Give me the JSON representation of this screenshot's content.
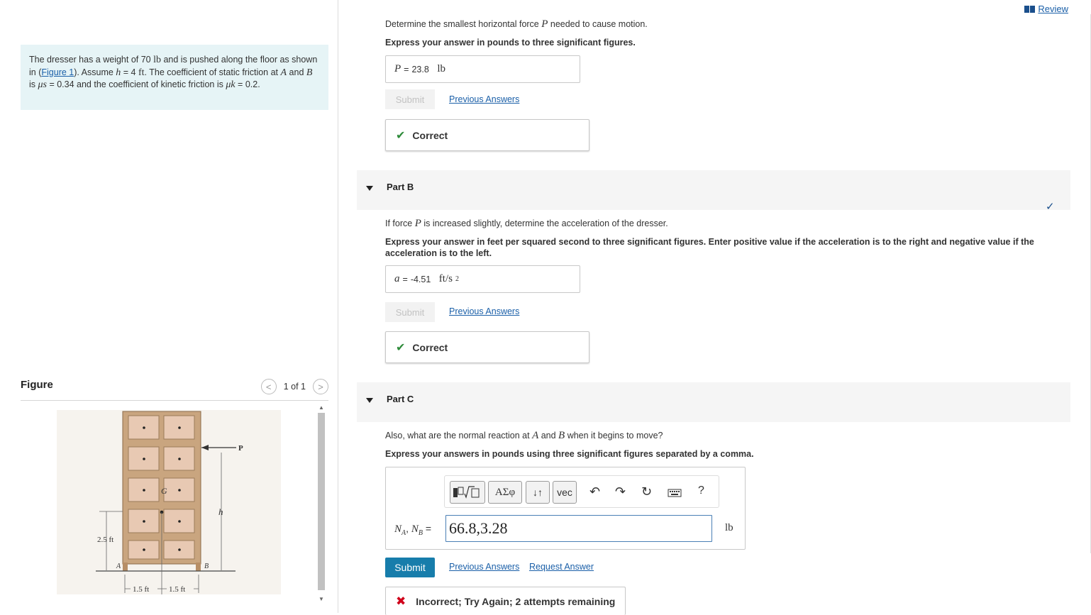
{
  "problem": {
    "t1": "The dresser has a weight of 70 ",
    "weight_unit": "lb",
    "t2": " and is pushed along the floor as shown in (",
    "figure_link": "Figure 1",
    "t3": "). Assume ",
    "h_sym": "h",
    "t4": " = 4 ",
    "ft_unit": "ft",
    "t5": ". The coefficient of static friction at ",
    "a_sym": "A",
    "t6": " and ",
    "b_sym": "B",
    "t7": " is ",
    "mus": "μs",
    "t8": " = 0.34 and the coefficient of kinetic friction is ",
    "muk": "μk",
    "t9": " = 0.2."
  },
  "figure_panel": {
    "title": "Figure",
    "page_indicator": "1 of 1",
    "prev_symbol": "<",
    "next_symbol": ">"
  },
  "figure": {
    "label_p": "P",
    "label_g": "G",
    "label_h": "h",
    "label_a": "A",
    "label_b": "B",
    "dim_height": "2.5 ft",
    "dim_left": "1.5 ft",
    "dim_right": "1.5 ft"
  },
  "header": {
    "review_label": "Review"
  },
  "part_a": {
    "q_pre": "Determine the smallest horizontal force ",
    "q_sym": "P",
    "q_post": " needed to cause motion.",
    "instruction": "Express your answer in pounds to three significant figures.",
    "answer_var": "P",
    "answer_eq": " = ",
    "answer_value": "23.8",
    "answer_unit": "lb",
    "submit_label": "Submit",
    "previous_answers": "Previous Answers",
    "feedback": "Correct"
  },
  "part_b": {
    "title": "Part B",
    "q_pre": "If force ",
    "q_sym": "P",
    "q_post": " is increased slightly, determine the acceleration of the dresser.",
    "instruction": "Express your answer in feet per squared second to three significant figures. Enter positive value if the acceleration is to the right and negative value if the acceleration is to the left.",
    "answer_var": "a",
    "answer_eq": " = ",
    "answer_value": "-4.51",
    "answer_unit": "ft/s",
    "answer_unit_exp": "2",
    "submit_label": "Submit",
    "previous_answers": "Previous Answers",
    "feedback": "Correct"
  },
  "part_c": {
    "title": "Part C",
    "q_pre": "Also, what are the normal reaction at ",
    "q_a": "A",
    "q_mid": " and ",
    "q_b": "B",
    "q_post": " when it begins to move?",
    "instruction": "Express your answers in pounds using three significant figures separated by a comma.",
    "toolbar": {
      "vec_label": "vec",
      "greek_label": "ΑΣφ",
      "arrows_label": "↓↑",
      "help_label": "?"
    },
    "label_na": "N",
    "label_na_sub": "A",
    "label_sep": ", ",
    "label_nb": "N",
    "label_nb_sub": "B",
    "label_eq": " = ",
    "input_value": "66.8,3.28",
    "unit": "lb",
    "submit_label": "Submit",
    "previous_answers": "Previous Answers",
    "request_answer": "Request Answer",
    "feedback": "Incorrect; Try Again; 2 attempts remaining"
  },
  "colors": {
    "problem_bg": "#e6f4f6",
    "link": "#1a5fa8",
    "submit_bg": "#177dab",
    "correct_green": "#2e8b3a",
    "incorrect_red": "#d0021b"
  }
}
